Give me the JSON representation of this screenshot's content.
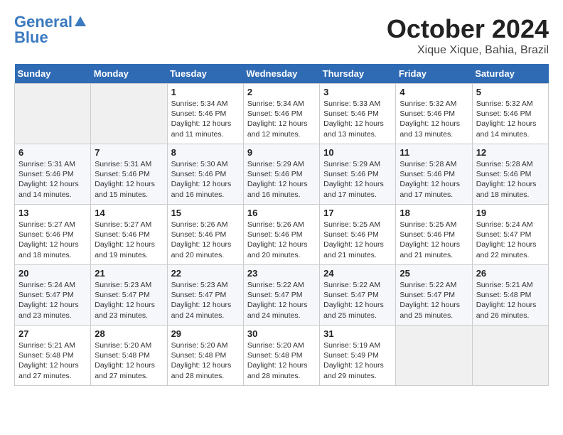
{
  "logo": {
    "line1": "General",
    "line2": "Blue"
  },
  "title": "October 2024",
  "location": "Xique Xique, Bahia, Brazil",
  "weekdays": [
    "Sunday",
    "Monday",
    "Tuesday",
    "Wednesday",
    "Thursday",
    "Friday",
    "Saturday"
  ],
  "weeks": [
    [
      {
        "day": "",
        "empty": true
      },
      {
        "day": "",
        "empty": true
      },
      {
        "day": "1",
        "sunrise": "Sunrise: 5:34 AM",
        "sunset": "Sunset: 5:46 PM",
        "daylight": "Daylight: 12 hours and 11 minutes."
      },
      {
        "day": "2",
        "sunrise": "Sunrise: 5:34 AM",
        "sunset": "Sunset: 5:46 PM",
        "daylight": "Daylight: 12 hours and 12 minutes."
      },
      {
        "day": "3",
        "sunrise": "Sunrise: 5:33 AM",
        "sunset": "Sunset: 5:46 PM",
        "daylight": "Daylight: 12 hours and 13 minutes."
      },
      {
        "day": "4",
        "sunrise": "Sunrise: 5:32 AM",
        "sunset": "Sunset: 5:46 PM",
        "daylight": "Daylight: 12 hours and 13 minutes."
      },
      {
        "day": "5",
        "sunrise": "Sunrise: 5:32 AM",
        "sunset": "Sunset: 5:46 PM",
        "daylight": "Daylight: 12 hours and 14 minutes."
      }
    ],
    [
      {
        "day": "6",
        "sunrise": "Sunrise: 5:31 AM",
        "sunset": "Sunset: 5:46 PM",
        "daylight": "Daylight: 12 hours and 14 minutes."
      },
      {
        "day": "7",
        "sunrise": "Sunrise: 5:31 AM",
        "sunset": "Sunset: 5:46 PM",
        "daylight": "Daylight: 12 hours and 15 minutes."
      },
      {
        "day": "8",
        "sunrise": "Sunrise: 5:30 AM",
        "sunset": "Sunset: 5:46 PM",
        "daylight": "Daylight: 12 hours and 16 minutes."
      },
      {
        "day": "9",
        "sunrise": "Sunrise: 5:29 AM",
        "sunset": "Sunset: 5:46 PM",
        "daylight": "Daylight: 12 hours and 16 minutes."
      },
      {
        "day": "10",
        "sunrise": "Sunrise: 5:29 AM",
        "sunset": "Sunset: 5:46 PM",
        "daylight": "Daylight: 12 hours and 17 minutes."
      },
      {
        "day": "11",
        "sunrise": "Sunrise: 5:28 AM",
        "sunset": "Sunset: 5:46 PM",
        "daylight": "Daylight: 12 hours and 17 minutes."
      },
      {
        "day": "12",
        "sunrise": "Sunrise: 5:28 AM",
        "sunset": "Sunset: 5:46 PM",
        "daylight": "Daylight: 12 hours and 18 minutes."
      }
    ],
    [
      {
        "day": "13",
        "sunrise": "Sunrise: 5:27 AM",
        "sunset": "Sunset: 5:46 PM",
        "daylight": "Daylight: 12 hours and 18 minutes."
      },
      {
        "day": "14",
        "sunrise": "Sunrise: 5:27 AM",
        "sunset": "Sunset: 5:46 PM",
        "daylight": "Daylight: 12 hours and 19 minutes."
      },
      {
        "day": "15",
        "sunrise": "Sunrise: 5:26 AM",
        "sunset": "Sunset: 5:46 PM",
        "daylight": "Daylight: 12 hours and 20 minutes."
      },
      {
        "day": "16",
        "sunrise": "Sunrise: 5:26 AM",
        "sunset": "Sunset: 5:46 PM",
        "daylight": "Daylight: 12 hours and 20 minutes."
      },
      {
        "day": "17",
        "sunrise": "Sunrise: 5:25 AM",
        "sunset": "Sunset: 5:46 PM",
        "daylight": "Daylight: 12 hours and 21 minutes."
      },
      {
        "day": "18",
        "sunrise": "Sunrise: 5:25 AM",
        "sunset": "Sunset: 5:46 PM",
        "daylight": "Daylight: 12 hours and 21 minutes."
      },
      {
        "day": "19",
        "sunrise": "Sunrise: 5:24 AM",
        "sunset": "Sunset: 5:47 PM",
        "daylight": "Daylight: 12 hours and 22 minutes."
      }
    ],
    [
      {
        "day": "20",
        "sunrise": "Sunrise: 5:24 AM",
        "sunset": "Sunset: 5:47 PM",
        "daylight": "Daylight: 12 hours and 23 minutes."
      },
      {
        "day": "21",
        "sunrise": "Sunrise: 5:23 AM",
        "sunset": "Sunset: 5:47 PM",
        "daylight": "Daylight: 12 hours and 23 minutes."
      },
      {
        "day": "22",
        "sunrise": "Sunrise: 5:23 AM",
        "sunset": "Sunset: 5:47 PM",
        "daylight": "Daylight: 12 hours and 24 minutes."
      },
      {
        "day": "23",
        "sunrise": "Sunrise: 5:22 AM",
        "sunset": "Sunset: 5:47 PM",
        "daylight": "Daylight: 12 hours and 24 minutes."
      },
      {
        "day": "24",
        "sunrise": "Sunrise: 5:22 AM",
        "sunset": "Sunset: 5:47 PM",
        "daylight": "Daylight: 12 hours and 25 minutes."
      },
      {
        "day": "25",
        "sunrise": "Sunrise: 5:22 AM",
        "sunset": "Sunset: 5:47 PM",
        "daylight": "Daylight: 12 hours and 25 minutes."
      },
      {
        "day": "26",
        "sunrise": "Sunrise: 5:21 AM",
        "sunset": "Sunset: 5:48 PM",
        "daylight": "Daylight: 12 hours and 26 minutes."
      }
    ],
    [
      {
        "day": "27",
        "sunrise": "Sunrise: 5:21 AM",
        "sunset": "Sunset: 5:48 PM",
        "daylight": "Daylight: 12 hours and 27 minutes."
      },
      {
        "day": "28",
        "sunrise": "Sunrise: 5:20 AM",
        "sunset": "Sunset: 5:48 PM",
        "daylight": "Daylight: 12 hours and 27 minutes."
      },
      {
        "day": "29",
        "sunrise": "Sunrise: 5:20 AM",
        "sunset": "Sunset: 5:48 PM",
        "daylight": "Daylight: 12 hours and 28 minutes."
      },
      {
        "day": "30",
        "sunrise": "Sunrise: 5:20 AM",
        "sunset": "Sunset: 5:48 PM",
        "daylight": "Daylight: 12 hours and 28 minutes."
      },
      {
        "day": "31",
        "sunrise": "Sunrise: 5:19 AM",
        "sunset": "Sunset: 5:49 PM",
        "daylight": "Daylight: 12 hours and 29 minutes."
      },
      {
        "day": "",
        "empty": true
      },
      {
        "day": "",
        "empty": true
      }
    ]
  ]
}
